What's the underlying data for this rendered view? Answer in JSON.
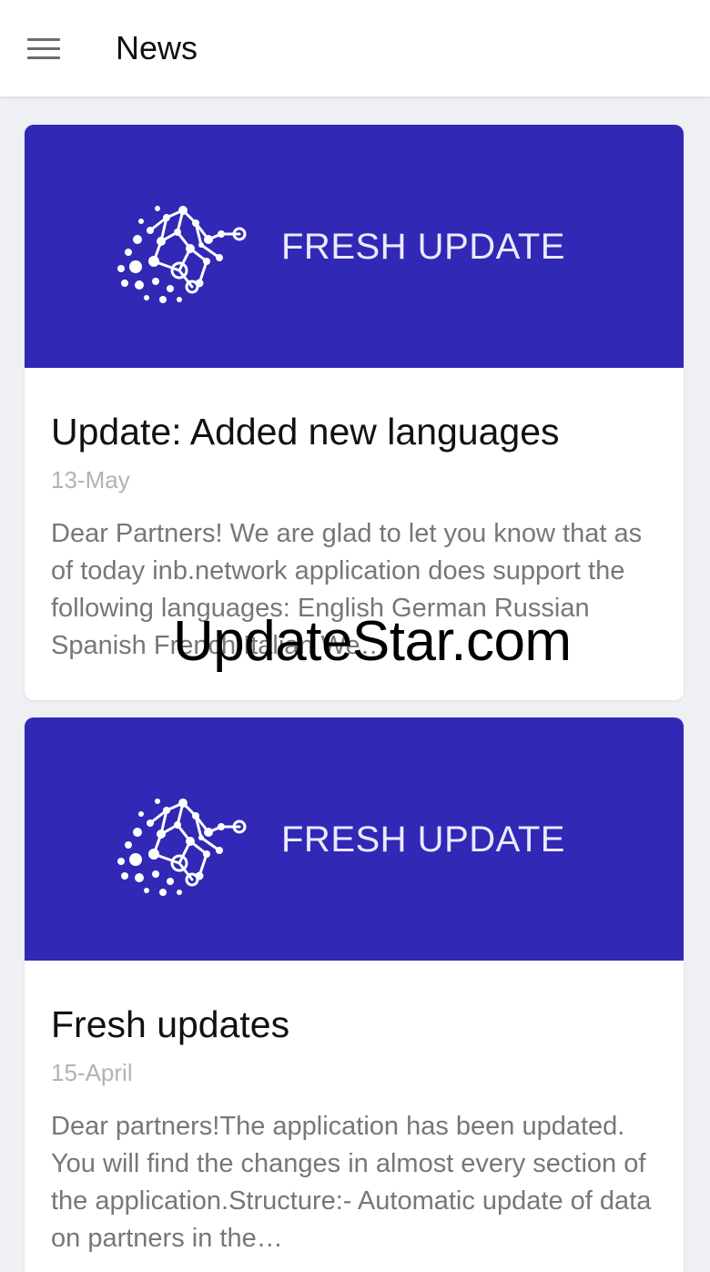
{
  "appbar": {
    "title": "News"
  },
  "news": [
    {
      "banner_text": "FRESH UPDATE",
      "title": "Update: Added new languages",
      "date": "13-May",
      "excerpt": "Dear Partners! We are glad to let you know that as of today inb.network application does support the following languages: English German Russian Spanish French Italian We…"
    },
    {
      "banner_text": "FRESH UPDATE",
      "title": "Fresh updates",
      "date": "15-April",
      "excerpt": "Dear partners!The application has been updated. You will find the changes in almost every section of the application.Structure:- Automatic update of data on partners in the…"
    }
  ],
  "watermark": "UpdateStar.com",
  "colors": {
    "banner_bg": "#3128b6",
    "page_bg": "#eef0f3",
    "title_text": "#111111",
    "date_text": "#b3b3b3",
    "excerpt_text": "#777777"
  },
  "icons": {
    "menu": "hamburger-menu-icon",
    "banner_logo": "network-brain-logo"
  }
}
